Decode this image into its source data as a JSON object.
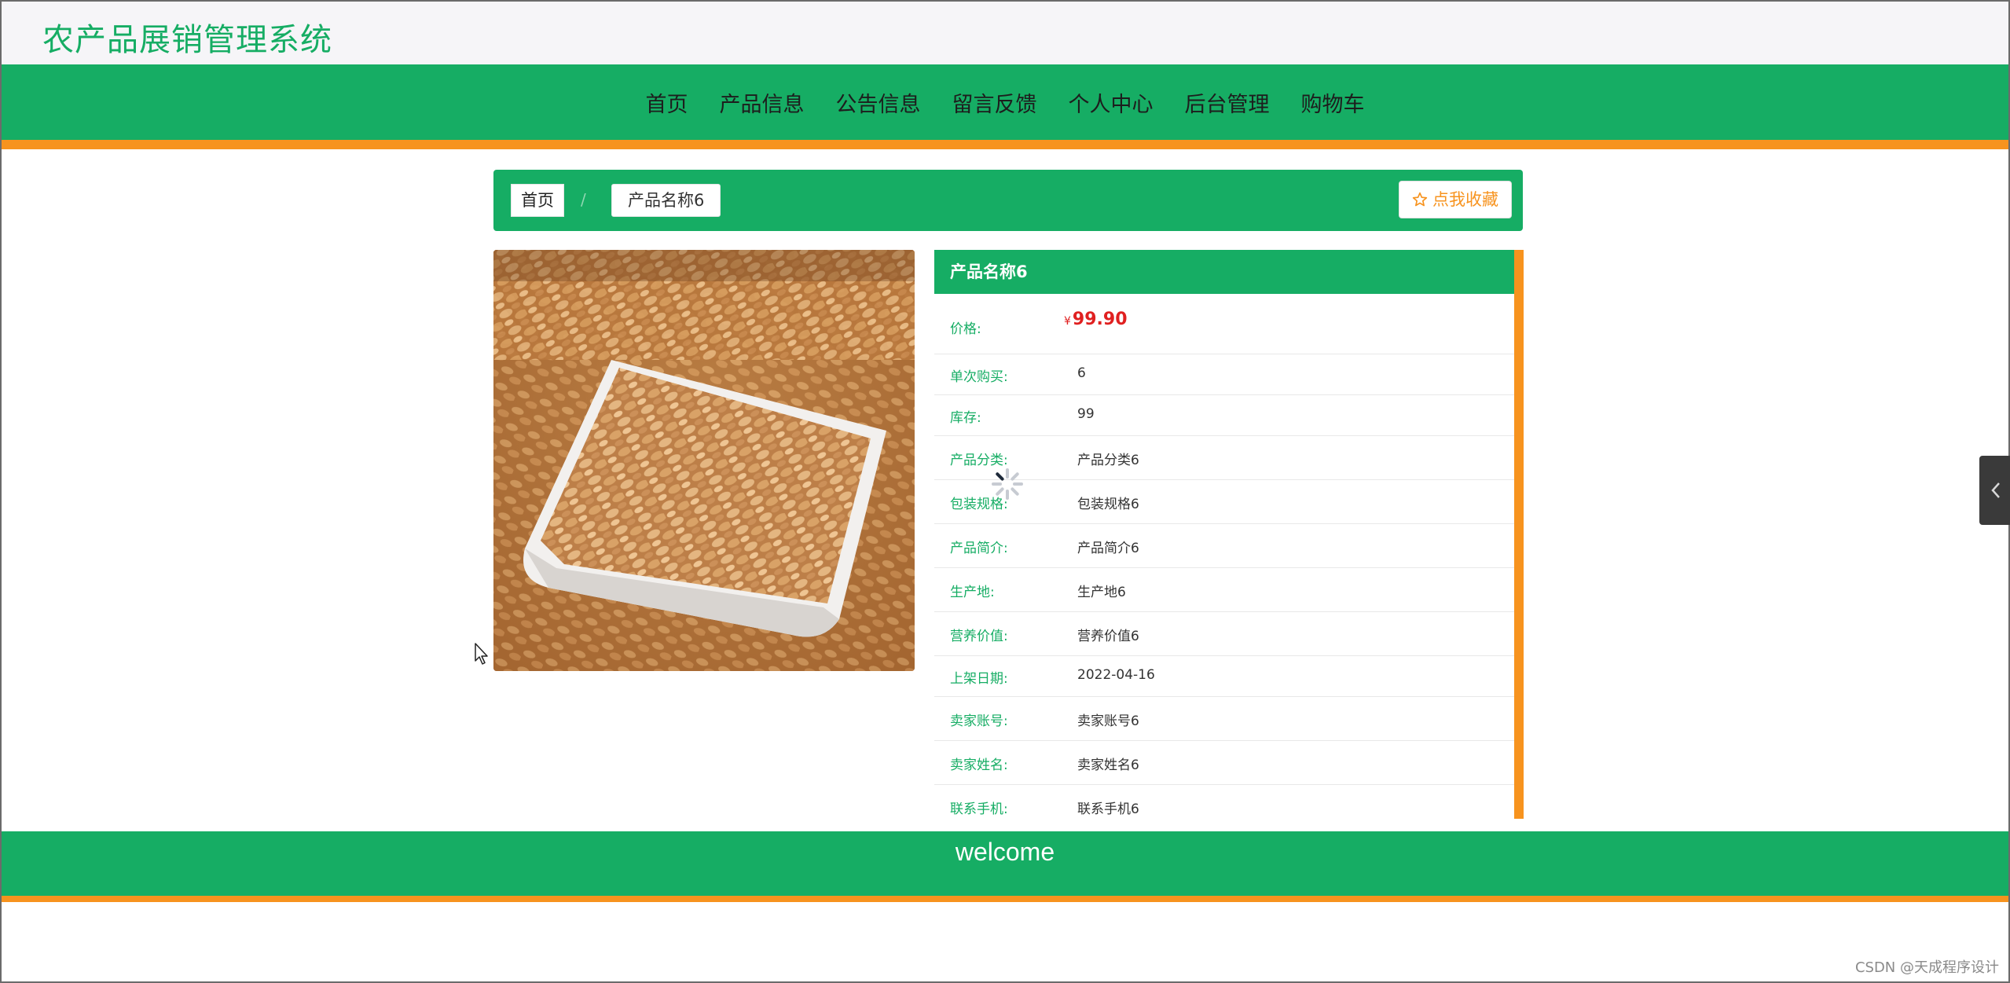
{
  "site": {
    "title": "农产品展销管理系统"
  },
  "nav": {
    "items": [
      "首页",
      "产品信息",
      "公告信息",
      "留言反馈",
      "个人中心",
      "后台管理",
      "购物车"
    ]
  },
  "breadcrumb": {
    "home": "首页",
    "separator": "/",
    "current": "产品名称6"
  },
  "favorite_button": {
    "label": "点我收藏",
    "icon": "star-outline-icon"
  },
  "product": {
    "name": "产品名称6",
    "price_label": "价格:",
    "currency": "¥",
    "price": "99.90",
    "fields": [
      {
        "label": "单次购买:",
        "value": "6"
      },
      {
        "label": "库存:",
        "value": "99"
      },
      {
        "label": "产品分类:",
        "value": "产品分类6"
      },
      {
        "label": "包装规格:",
        "value": "包装规格6"
      },
      {
        "label": "产品简介:",
        "value": "产品简介6"
      },
      {
        "label": "生产地:",
        "value": "生产地6"
      },
      {
        "label": "营养价值:",
        "value": "营养价值6"
      },
      {
        "label": "上架日期:",
        "value": "2022-04-16"
      },
      {
        "label": "卖家账号:",
        "value": "卖家账号6"
      },
      {
        "label": "卖家姓名:",
        "value": "卖家姓名6"
      },
      {
        "label": "联系手机:",
        "value": "联系手机6"
      }
    ]
  },
  "footer": {
    "text": "welcome"
  },
  "watermark": "CSDN @天成程序设计",
  "colors": {
    "primary": "#16ad64",
    "accent": "#f7931e",
    "price": "#e02020"
  }
}
